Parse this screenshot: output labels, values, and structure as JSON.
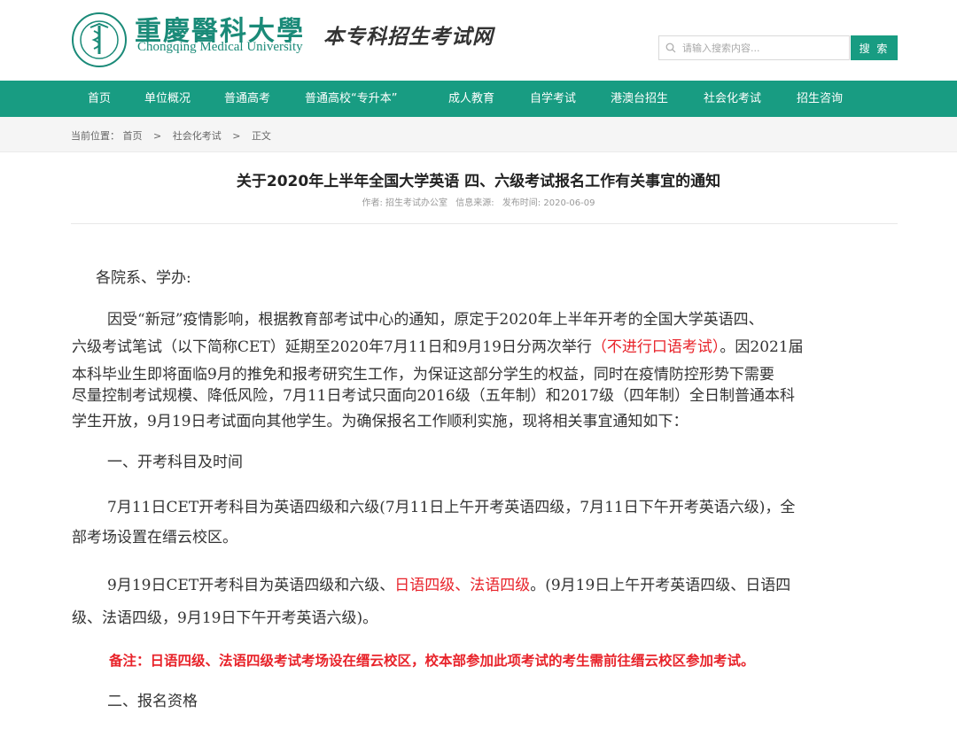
{
  "header": {
    "logo_cn": "重慶醫科大學",
    "logo_en": "Chongqing Medical University",
    "logo_sub": "本专科招生考试网",
    "search_placeholder": "请输入搜索内容...",
    "search_button": "搜 索"
  },
  "nav": {
    "items": [
      "首页",
      "单位概况",
      "普通高考",
      "普通高校“专升本”",
      "成人教育",
      "自学考试",
      "港澳台招生",
      "社会化考试",
      "招生咨询"
    ]
  },
  "breadcrumb": {
    "prefix": "当前位置：",
    "items": [
      "首页",
      "社会化考试",
      "正文"
    ],
    "sep": ">"
  },
  "article": {
    "title": "关于2020年上半年全国大学英语 四、六级考试报名工作有关事宜的通知",
    "author": "作者: 招生考试办公室",
    "source": "信息来源:",
    "date": "发布时间: 2020-06-09",
    "greeting": "各院系、学办:",
    "p1_a": "因受“新冠”疫情影响，根据教育部考试中心的通知，原定于2020年上半年开考的全国大学英语四、",
    "p1_b": "六级考试笔试（以下简称CET）延期至2020年7月11日和9月19日分两次举行",
    "p1_red": "（不进行口语考试）",
    "p1_c": "。因2021届",
    "p1_d": "本科毕业生即将面临9月的推免和报考研究生工作，为保证这部分学生的权益，同时在疫情防控形势下需要",
    "p1_e": "尽量控制考试规模、降低风险，7月11日考试只面向2016级（五年制）和2017级（四年制）全日制普通本科",
    "p1_f": "学生开放，9月19日考试面向其他学生。为确保报名工作顺利实施，现将相关事宜通知如下：",
    "section1": "一、开考科目及时间",
    "p2_a": "7月11日CET开考科目为英语四级和六级(7月11日上午开考英语四级，7月11日下午开考英语六级)，全",
    "p2_b": "部考场设置在缙云校区。",
    "p3_a": "9月19日CET开考科目为英语四级和六级、",
    "p3_red": "日语四级、法语四级",
    "p3_b": "。(9月19日上午开考英语四级、日语四",
    "p3_c": "级、法语四级，9月19日下午开考英语六级)。",
    "note": "备注：日语四级、法语四级考试考场设在缙云校区，校本部参加此项考试的考生需前往缙云校区参加考试。",
    "section2": "二、报名资格"
  }
}
